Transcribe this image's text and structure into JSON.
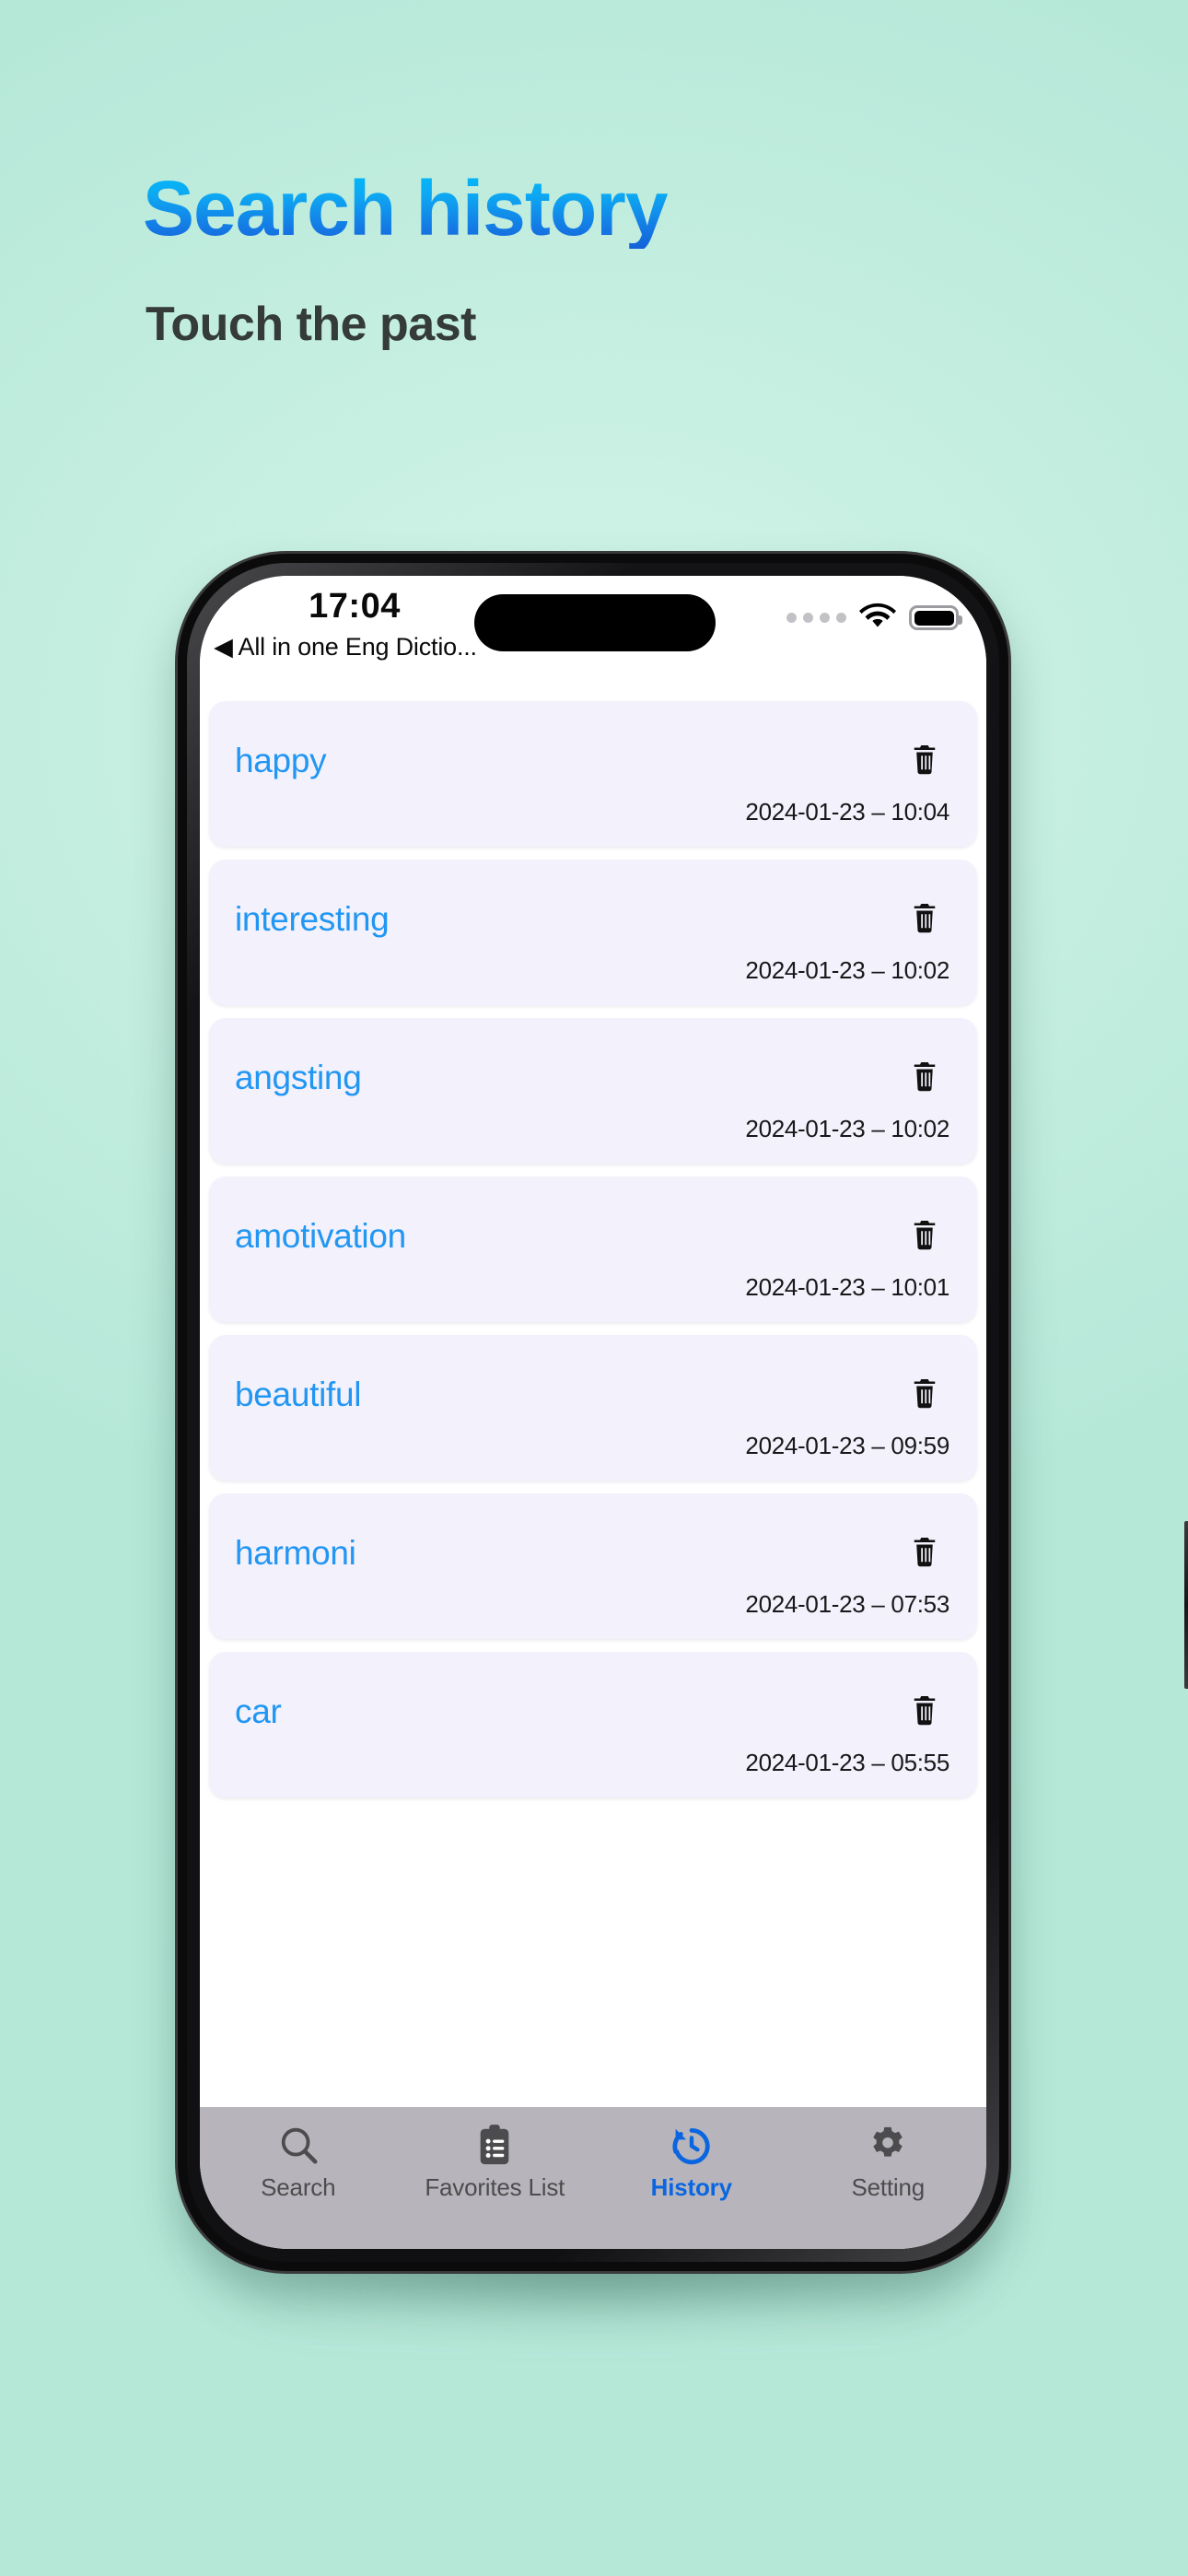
{
  "promo": {
    "title": "Search history",
    "subtitle": "Touch the past",
    "title_gradient_from": "#00BEFA",
    "title_gradient_to": "#1361D6",
    "subtitle_color": "#343B39",
    "background_color": "#C6EFE1"
  },
  "status_bar": {
    "time": "17:04",
    "back_label": "◀ All in one Eng Dictio...",
    "signal_icon": "signal-dots-icon",
    "wifi_icon": "wifi-icon",
    "battery_icon": "battery-full-icon"
  },
  "history": {
    "delete_icon": "trash-icon",
    "word_color": "#2196F3",
    "card_color": "#F3F1FB",
    "items": [
      {
        "word": "happy",
        "date": "2024-01-23 – 10:04"
      },
      {
        "word": "interesting",
        "date": "2024-01-23 – 10:02"
      },
      {
        "word": "angsting",
        "date": "2024-01-23 – 10:02"
      },
      {
        "word": "amotivation",
        "date": "2024-01-23 – 10:01"
      },
      {
        "word": "beautiful",
        "date": "2024-01-23 – 09:59"
      },
      {
        "word": "harmoni",
        "date": "2024-01-23 – 07:53"
      },
      {
        "word": "car",
        "date": "2024-01-23 – 05:55"
      }
    ]
  },
  "tabbar": {
    "active_color": "#0A66E0",
    "inactive_color": "#4C4C4E",
    "background_color": "#B7B5BB",
    "tabs": [
      {
        "label": "Search",
        "icon": "search-icon",
        "active": false
      },
      {
        "label": "Favorites List",
        "icon": "clipboard-icon",
        "active": false
      },
      {
        "label": "History",
        "icon": "history-icon",
        "active": true
      },
      {
        "label": "Setting",
        "icon": "gear-icon",
        "active": false
      }
    ]
  }
}
